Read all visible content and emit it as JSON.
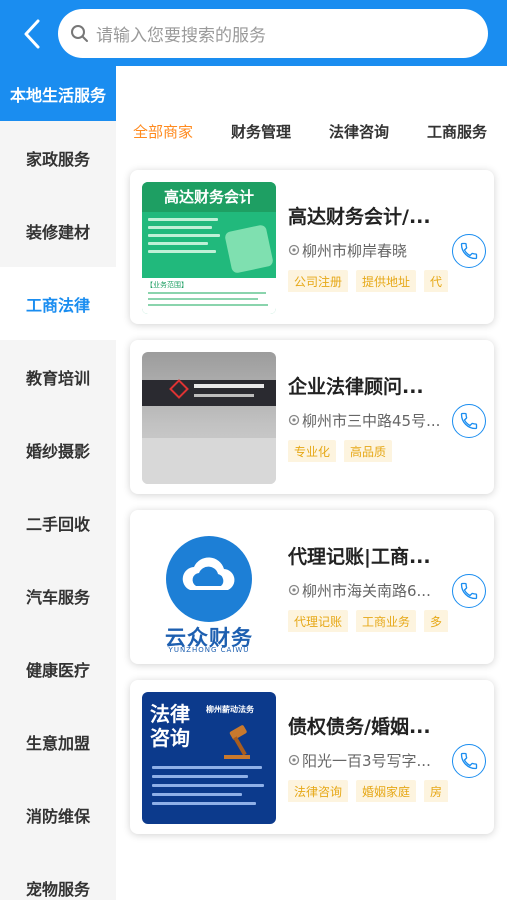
{
  "header": {
    "search_placeholder": "请输入您要搜索的服务"
  },
  "sidebar": {
    "items": [
      {
        "label": "本地生活服务"
      },
      {
        "label": "家政服务"
      },
      {
        "label": "装修建材"
      },
      {
        "label": "工商法律"
      },
      {
        "label": "教育培训"
      },
      {
        "label": "婚纱摄影"
      },
      {
        "label": "二手回收"
      },
      {
        "label": "汽车服务"
      },
      {
        "label": "健康医疗"
      },
      {
        "label": "生意加盟"
      },
      {
        "label": "消防维保"
      },
      {
        "label": "宠物服务"
      }
    ],
    "active_index": 3
  },
  "tabs": [
    {
      "label": "全部商家"
    },
    {
      "label": "财务管理"
    },
    {
      "label": "法律咨询"
    },
    {
      "label": "工商服务"
    }
  ],
  "cards": [
    {
      "title": "高达财务会计/...",
      "address": "柳州市柳岸春晓",
      "tags": [
        "公司注册",
        "提供地址",
        "代"
      ],
      "thumb": {
        "heading": "高达财务会计",
        "footer_label": "【业务范围】"
      }
    },
    {
      "title": "企业法律顾问...",
      "address": "柳州市三中路45号...",
      "tags": [
        "专业化",
        "高品质"
      ],
      "thumb": {}
    },
    {
      "title": "代理记账|工商...",
      "address": "柳州市海关南路6...",
      "tags": [
        "代理记账",
        "工商业务",
        "多"
      ],
      "thumb": {
        "brand": "云众财务",
        "sub": "YUNZHONG CAIWU"
      }
    },
    {
      "title": "债权债务/婚姻...",
      "address": "阳光一百3号写字...",
      "tags": [
        "法律咨询",
        "婚姻家庭",
        "房"
      ],
      "thumb": {
        "heading": "法律咨询",
        "right": "柳州薪动法务"
      }
    }
  ],
  "colors": {
    "primary": "#1a8df0",
    "accent": "#ff8a1e",
    "tag_text": "#e6a817",
    "tag_bg": "#fdf4df"
  }
}
